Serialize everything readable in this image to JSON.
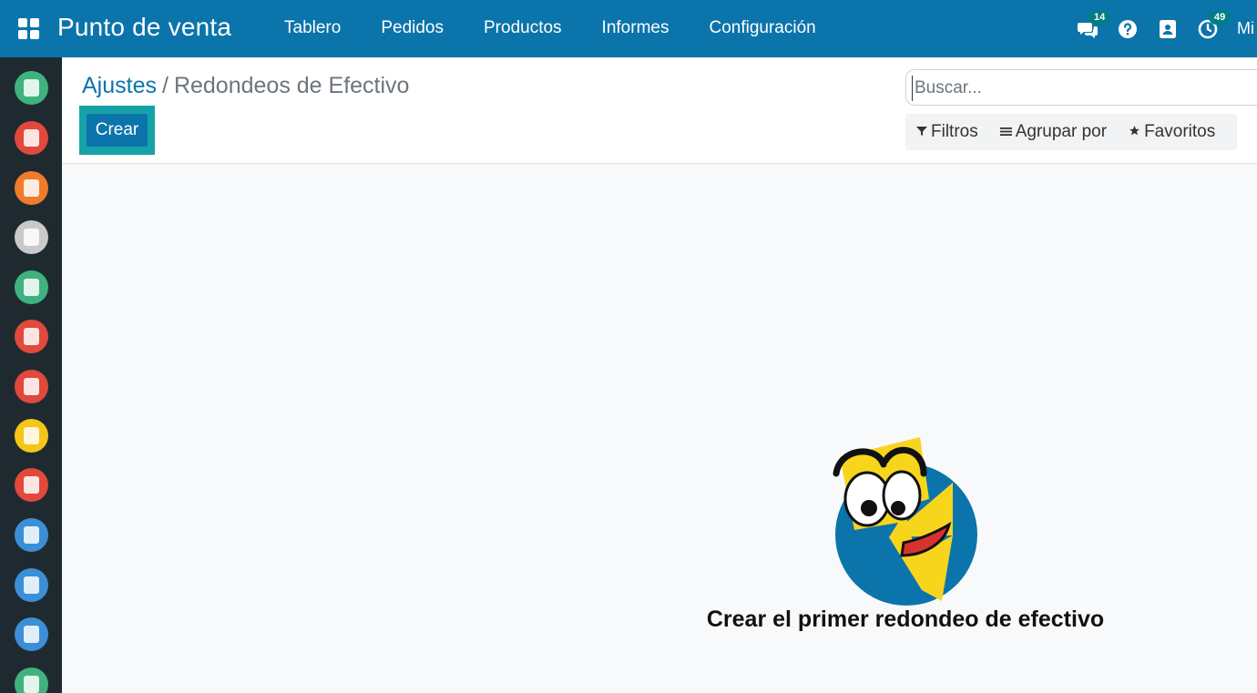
{
  "navbar": {
    "brand": "Punto de venta",
    "menu": [
      "Tablero",
      "Pedidos",
      "Productos",
      "Informes",
      "Configuración"
    ],
    "systray": {
      "messages_badge": "14",
      "activities_badge": "49",
      "user_label": "Mi"
    }
  },
  "appbar": {
    "icon_colors": [
      "#3fb27f",
      "#e0493b",
      "#f07b2b",
      "#c9c9c9",
      "#3fb27f",
      "#e0493b",
      "#e0493b",
      "#f5c518",
      "#e0493b",
      "#3b8fd6",
      "#3b8fd6",
      "#3b8fd6",
      "#3fb27f"
    ]
  },
  "breadcrumb": {
    "parent": "Ajustes",
    "separator": "/",
    "current": "Redondeos de Efectivo"
  },
  "toolbar": {
    "create_label": "Crear"
  },
  "search": {
    "placeholder": "Buscar..."
  },
  "filters": {
    "filters_label": "Filtros",
    "group_by_label": "Agrupar por",
    "favorites_label": "Favoritos"
  },
  "empty_state": {
    "title": "Crear el primer redondeo de efectivo"
  },
  "colors": {
    "brand": "#0b74ab",
    "focus": "#17a2a8",
    "sidebar": "#1f2a30"
  }
}
